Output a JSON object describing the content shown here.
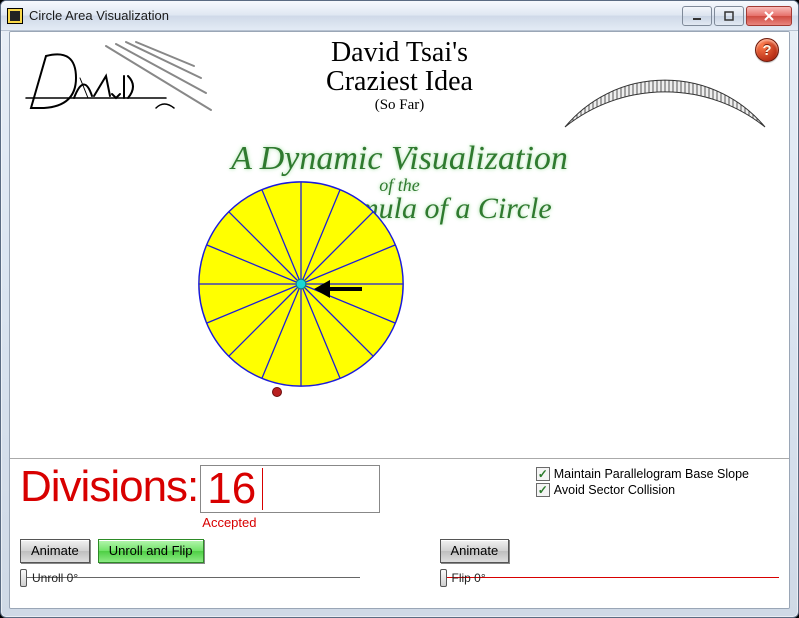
{
  "window": {
    "title": "Circle Area Visualization"
  },
  "heading": {
    "line1": "David Tsai's",
    "line2": "Craziest Idea",
    "sofar": "(So Far)"
  },
  "subtitle": {
    "line1": "A Dynamic Visualization",
    "line2": "of the",
    "line3": "Area Formula of a Circle"
  },
  "divisions": {
    "label": "Divisions:",
    "value": "16",
    "status": "Accepted"
  },
  "options": {
    "opt1": {
      "label": "Maintain Parallelogram Base Slope",
      "checked": true
    },
    "opt2": {
      "label": "Avoid Sector Collision",
      "checked": true
    }
  },
  "controls": {
    "animate": "Animate",
    "unroll_flip": "Unroll and Flip",
    "unroll_slider": "Unroll 0°",
    "flip_slider": "Flip 0°"
  },
  "icons": {
    "help": "?"
  }
}
